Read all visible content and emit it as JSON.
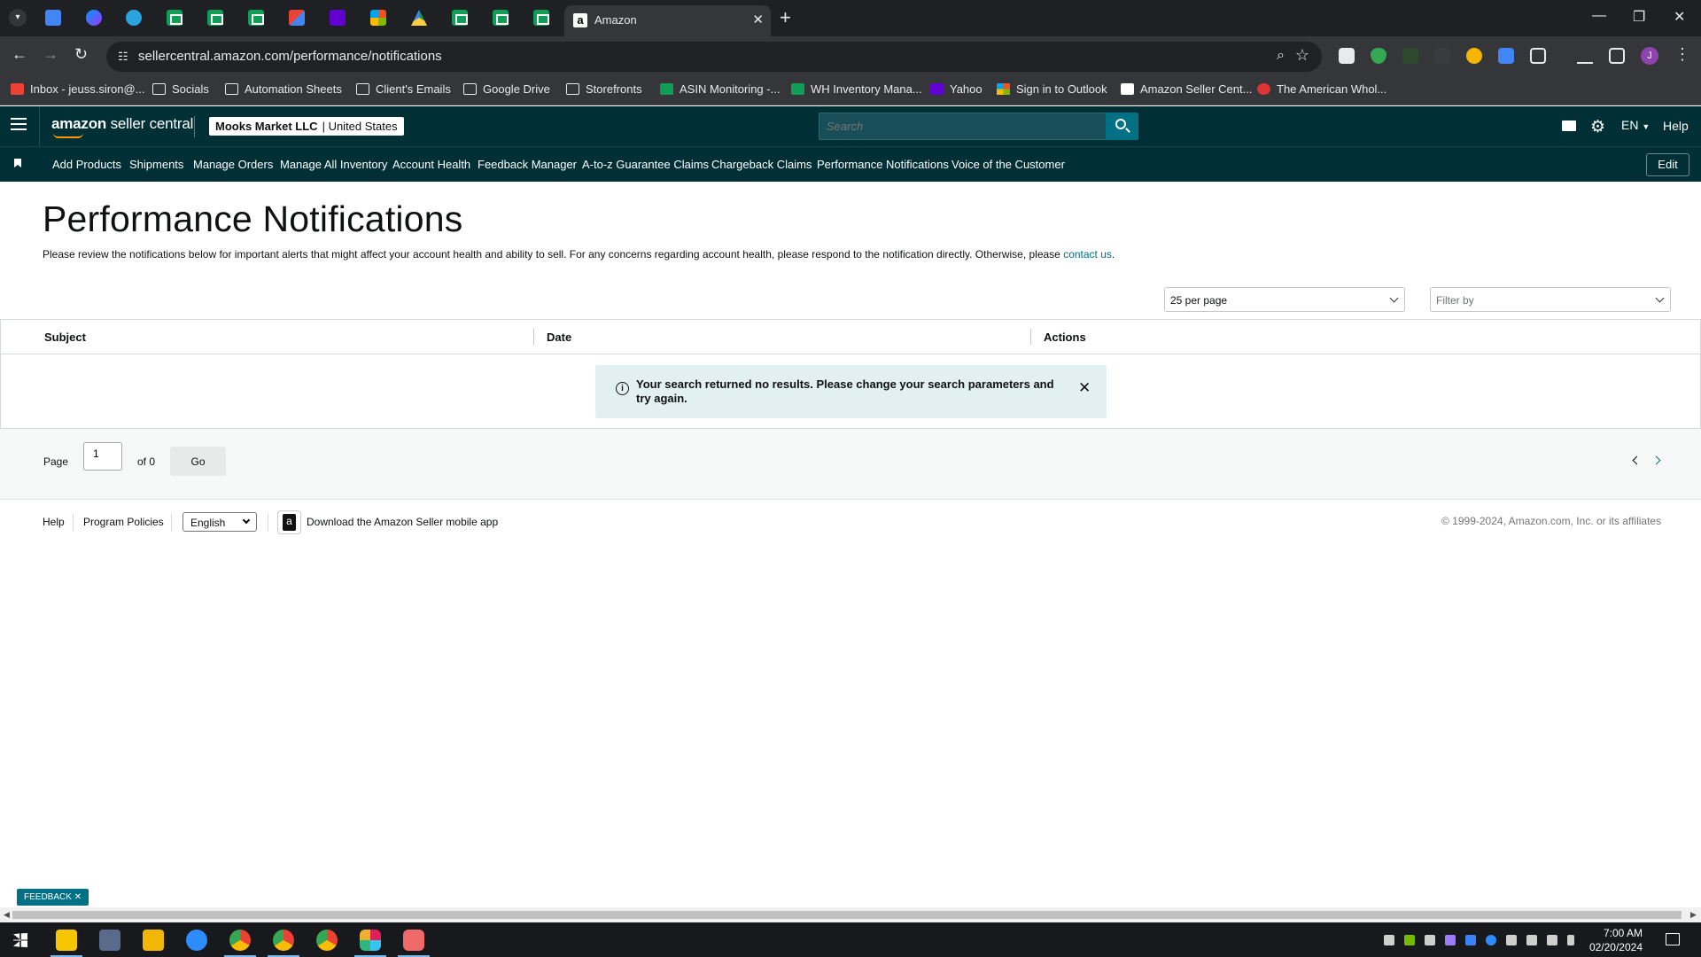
{
  "browser": {
    "active_tab_title": "Amazon",
    "url": "sellercentral.amazon.com/performance/notifications",
    "bookmarks": [
      {
        "label": "Inbox - jeuss.siron@...",
        "icon": "gmail-icon"
      },
      {
        "label": "Socials",
        "icon": "folder-icon"
      },
      {
        "label": "Automation Sheets",
        "icon": "folder-icon"
      },
      {
        "label": "Client's Emails",
        "icon": "folder-icon"
      },
      {
        "label": "Google Drive",
        "icon": "folder-icon"
      },
      {
        "label": "Storefronts",
        "icon": "folder-icon"
      },
      {
        "label": "ASIN Monitoring -...",
        "icon": "sheets-icon"
      },
      {
        "label": "WH Inventory Mana...",
        "icon": "sheets-icon"
      },
      {
        "label": "Yahoo",
        "icon": "yahoo-icon"
      },
      {
        "label": "Sign in to Outlook",
        "icon": "microsoft-icon"
      },
      {
        "label": "Amazon Seller Cent...",
        "icon": "amazon-icon"
      },
      {
        "label": "The American Whol...",
        "icon": "site-icon"
      }
    ],
    "profile_initial": "J"
  },
  "header": {
    "logo_bold": "amazon",
    "logo_rest": " seller central",
    "account_name": "Mooks Market LLC",
    "account_region": "| United States",
    "search_placeholder": "Search",
    "language": "EN",
    "help": "Help"
  },
  "nav": {
    "items": [
      "Add Products",
      "Shipments",
      "Manage Orders",
      "Manage All Inventory",
      "Account Health",
      "Feedback Manager",
      "A-to-z Guarantee Claims",
      "Chargeback Claims",
      "Performance Notifications",
      "Voice of the Customer"
    ],
    "edit_label": "Edit"
  },
  "main": {
    "title": "Performance Notifications",
    "description": "Please review the notifications below for important alerts that might affect your account health and ability to sell. For any concerns regarding account health, please respond to the notification directly. Otherwise, please ",
    "contact_link": "contact us",
    "description_end": ".",
    "per_page": "25 per page",
    "filter_placeholder": "Filter by",
    "columns": [
      "Subject",
      "Date",
      "Actions"
    ],
    "alert_text": "Your search returned no results. Please change your search parameters and try again."
  },
  "pager": {
    "page_label": "Page",
    "page_value": "1",
    "of_label": "of 0",
    "go_label": "Go"
  },
  "footer": {
    "help": "Help",
    "program_policies": "Program Policies",
    "language": "English",
    "app_download": "Download the Amazon Seller mobile app",
    "copyright": "© 1999-2024, Amazon.com, Inc. or its affiliates"
  },
  "feedback_label": "FEEDBACK",
  "taskbar": {
    "time": "7:00 AM",
    "date": "02/20/2024"
  },
  "colors": {
    "header_bg": "#002f36",
    "accent": "#007185",
    "alert_bg": "#e3f0f2"
  }
}
